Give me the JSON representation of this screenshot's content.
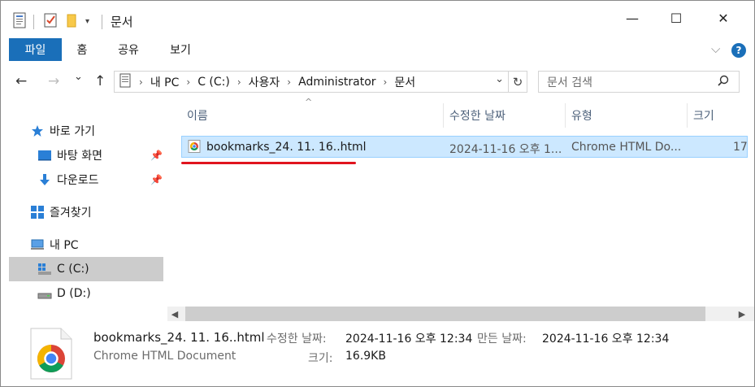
{
  "window": {
    "title": "문서",
    "minimize": "—",
    "maximize": "☐",
    "close": "✕"
  },
  "ribbon": {
    "tabs": [
      "파일",
      "홈",
      "공유",
      "보기"
    ],
    "expand": "⌵",
    "help": "?"
  },
  "address": {
    "back": "←",
    "forward": "→",
    "recent": "⌄",
    "up": "↑",
    "crumbs": [
      "내 PC",
      "C (C:)",
      "사용자",
      "Administrator",
      "문서"
    ],
    "dropdown": "⌄",
    "refresh": "↻",
    "search_placeholder": "문서 검색"
  },
  "nav": {
    "items": [
      {
        "label": "바로 가기",
        "icon": "star-icon"
      },
      {
        "label": "바탕 화면",
        "icon": "desktop-icon",
        "pinned": true
      },
      {
        "label": "다운로드",
        "icon": "download-icon",
        "pinned": true
      },
      {
        "label": "즐겨찾기",
        "icon": "favorites-icon"
      },
      {
        "label": "내 PC",
        "icon": "pc-icon"
      },
      {
        "label": "C (C:)",
        "icon": "drive-c-icon",
        "selected": true
      },
      {
        "label": "D (D:)",
        "icon": "drive-d-icon"
      }
    ]
  },
  "columns": {
    "name": "이름",
    "modified": "수정한 날짜",
    "type": "유형",
    "size": "크기"
  },
  "files": [
    {
      "name": "bookmarks_24. 11. 16..html",
      "modified": "2024-11-16 오후 1...",
      "type": "Chrome HTML Do...",
      "size": "17"
    }
  ],
  "details": {
    "filename": "bookmarks_24. 11. 16..html",
    "filetype": "Chrome HTML Document",
    "modified_label": "수정한 날짜:",
    "modified_value": "2024-11-16 오후 12:34",
    "created_label": "만든 날짜:",
    "created_value": "2024-11-16 오후 12:34",
    "size_label": "크기:",
    "size_value": "16.9KB"
  },
  "colors": {
    "accent": "#1a6fb9",
    "selection": "#cce8ff",
    "highlight_underline": "#e0141e"
  }
}
